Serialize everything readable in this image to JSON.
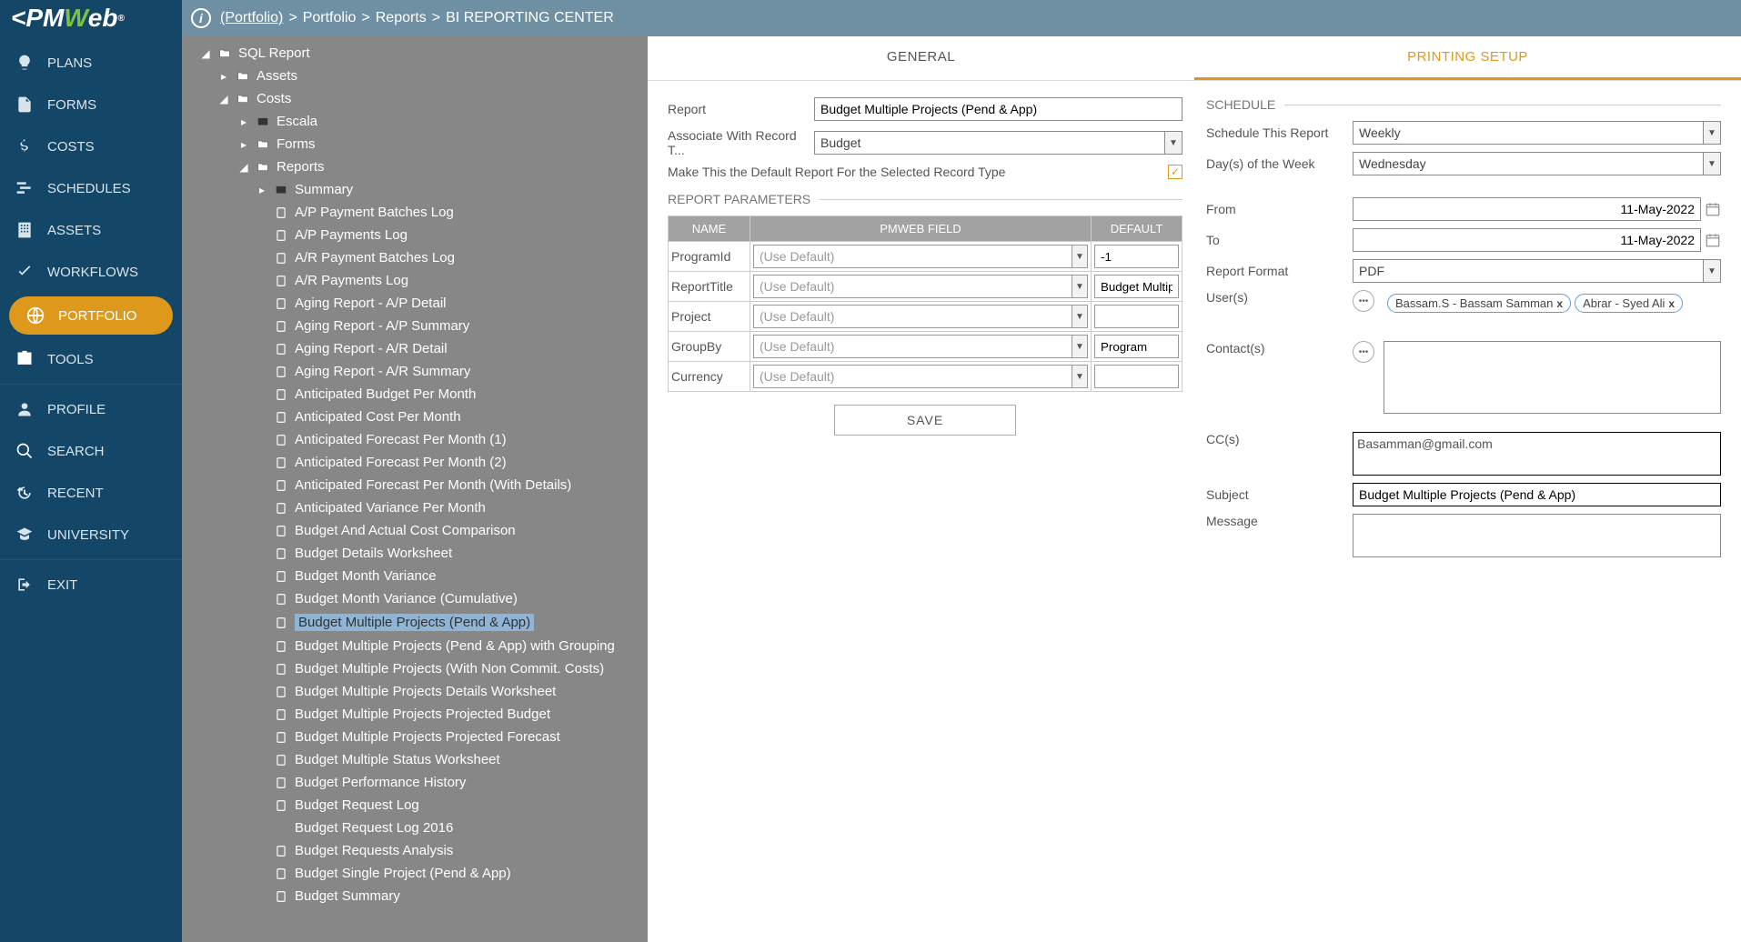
{
  "logo": {
    "pre": "<PM",
    "w": "W",
    "post": "eb",
    "reg": "®"
  },
  "breadcrumb": {
    "root": "(Portfolio)",
    "sep": ">",
    "parts": [
      "Portfolio",
      "Reports",
      "BI REPORTING CENTER"
    ]
  },
  "nav": [
    {
      "label": "PLANS"
    },
    {
      "label": "FORMS"
    },
    {
      "label": "COSTS"
    },
    {
      "label": "SCHEDULES"
    },
    {
      "label": "ASSETS"
    },
    {
      "label": "WORKFLOWS"
    },
    {
      "label": "PORTFOLIO",
      "active": true
    },
    {
      "label": "TOOLS"
    }
  ],
  "nav2": [
    {
      "label": "PROFILE"
    },
    {
      "label": "SEARCH"
    },
    {
      "label": "RECENT"
    },
    {
      "label": "UNIVERSITY"
    }
  ],
  "navExit": "EXIT",
  "tree": {
    "root": "SQL Report",
    "assets": "Assets",
    "costs": "Costs",
    "escala": "Escala",
    "forms": "Forms",
    "reports": "Reports",
    "summary": "Summary",
    "items": [
      "A/P Payment Batches Log",
      "A/P Payments Log",
      "A/R Payment Batches Log",
      "A/R Payments Log",
      "Aging Report - A/P Detail",
      "Aging Report - A/P Summary",
      "Aging Report - A/R Detail",
      "Aging Report - A/R Summary",
      "Anticipated Budget Per Month",
      "Anticipated Cost Per Month",
      "Anticipated Forecast Per Month (1)",
      "Anticipated Forecast Per Month (2)",
      "Anticipated Forecast Per Month (With Details)",
      "Anticipated Variance Per Month",
      "Budget And Actual Cost Comparison",
      "Budget Details Worksheet",
      "Budget Month Variance",
      "Budget Month Variance (Cumulative)",
      "Budget Multiple Projects (Pend & App)",
      "Budget Multiple Projects (Pend & App) with Grouping",
      "Budget Multiple Projects (With Non Commit. Costs)",
      "Budget Multiple Projects Details Worksheet",
      "Budget Multiple Projects Projected Budget",
      "Budget Multiple Projects Projected Forecast",
      "Budget Multiple Status Worksheet",
      "Budget Performance History",
      "Budget Request Log",
      "Budget Request Log 2016",
      "Budget Requests Analysis",
      "Budget Single Project (Pend & App)",
      "Budget Summary"
    ],
    "selectedIndex": 18
  },
  "tabs": {
    "general": "GENERAL",
    "printing": "PRINTING SETUP"
  },
  "form": {
    "reportLabel": "Report",
    "reportValue": "Budget Multiple Projects (Pend & App)",
    "assocLabel": "Associate With Record T...",
    "assocValue": "Budget",
    "defaultLabel": "Make This the Default Report For the Selected Record Type",
    "paramsHeader": "REPORT PARAMETERS",
    "thName": "NAME",
    "thField": "PMWEB FIELD",
    "thDefault": "DEFAULT",
    "params": [
      {
        "name": "ProgramId",
        "field": "(Use Default)",
        "def": "-1"
      },
      {
        "name": "ReportTitle",
        "field": "(Use Default)",
        "def": "Budget Multiple"
      },
      {
        "name": "Project",
        "field": "(Use Default)",
        "def": ""
      },
      {
        "name": "GroupBy",
        "field": "(Use Default)",
        "def": "Program"
      },
      {
        "name": "Currency",
        "field": "(Use Default)",
        "def": ""
      }
    ],
    "save": "SAVE"
  },
  "schedule": {
    "header": "SCHEDULE",
    "scheduleLabel": "Schedule This Report",
    "scheduleValue": "Weekly",
    "daysLabel": "Day(s) of the Week",
    "daysValue": "Wednesday",
    "fromLabel": "From",
    "fromValue": "11-May-2022",
    "toLabel": "To",
    "toValue": "11-May-2022",
    "formatLabel": "Report Format",
    "formatValue": "PDF",
    "usersLabel": "User(s)",
    "users": [
      "Bassam.S - Bassam Samman",
      "Abrar - Syed Ali"
    ],
    "contactsLabel": "Contact(s)",
    "ccLabel": "CC(s)",
    "ccValue": "Basamman@gmail.com",
    "subjectLabel": "Subject",
    "subjectValue": "Budget Multiple Projects (Pend & App)",
    "messageLabel": "Message"
  }
}
